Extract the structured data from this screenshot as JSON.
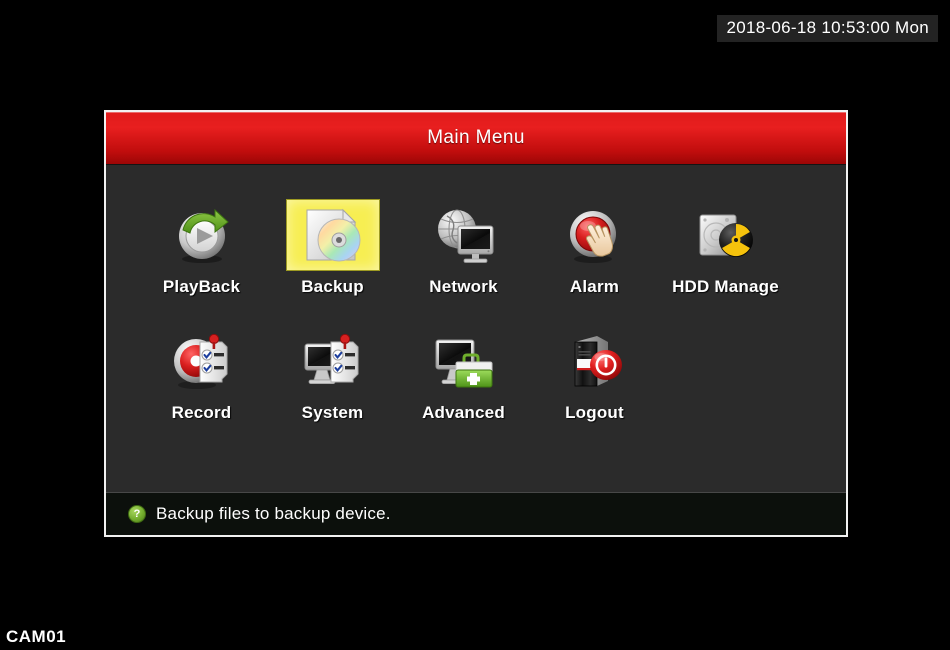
{
  "overlay": {
    "timestamp": "2018-06-18 10:53:00 Mon",
    "camera_label": "CAM01"
  },
  "dialog": {
    "title": "Main Menu",
    "accent_color": "#e01b1b",
    "body_color": "#2b2b2b",
    "selection_color": "#f7ee52",
    "rows": [
      [
        {
          "label": "PlayBack",
          "icon": "playback-icon",
          "selected": false
        },
        {
          "label": "Backup",
          "icon": "backup-disc-icon",
          "selected": true
        },
        {
          "label": "Network",
          "icon": "network-icon",
          "selected": false
        },
        {
          "label": "Alarm",
          "icon": "alarm-icon",
          "selected": false
        },
        {
          "label": "HDD Manage",
          "icon": "hdd-manage-icon",
          "selected": false
        }
      ],
      [
        {
          "label": "Record",
          "icon": "record-icon",
          "selected": false
        },
        {
          "label": "System",
          "icon": "system-icon",
          "selected": false
        },
        {
          "label": "Advanced",
          "icon": "advanced-icon",
          "selected": false
        },
        {
          "label": "Logout",
          "icon": "logout-icon",
          "selected": false
        }
      ]
    ]
  },
  "status": {
    "icon": "help-icon",
    "icon_glyph": "?",
    "text": "Backup files to backup device."
  }
}
